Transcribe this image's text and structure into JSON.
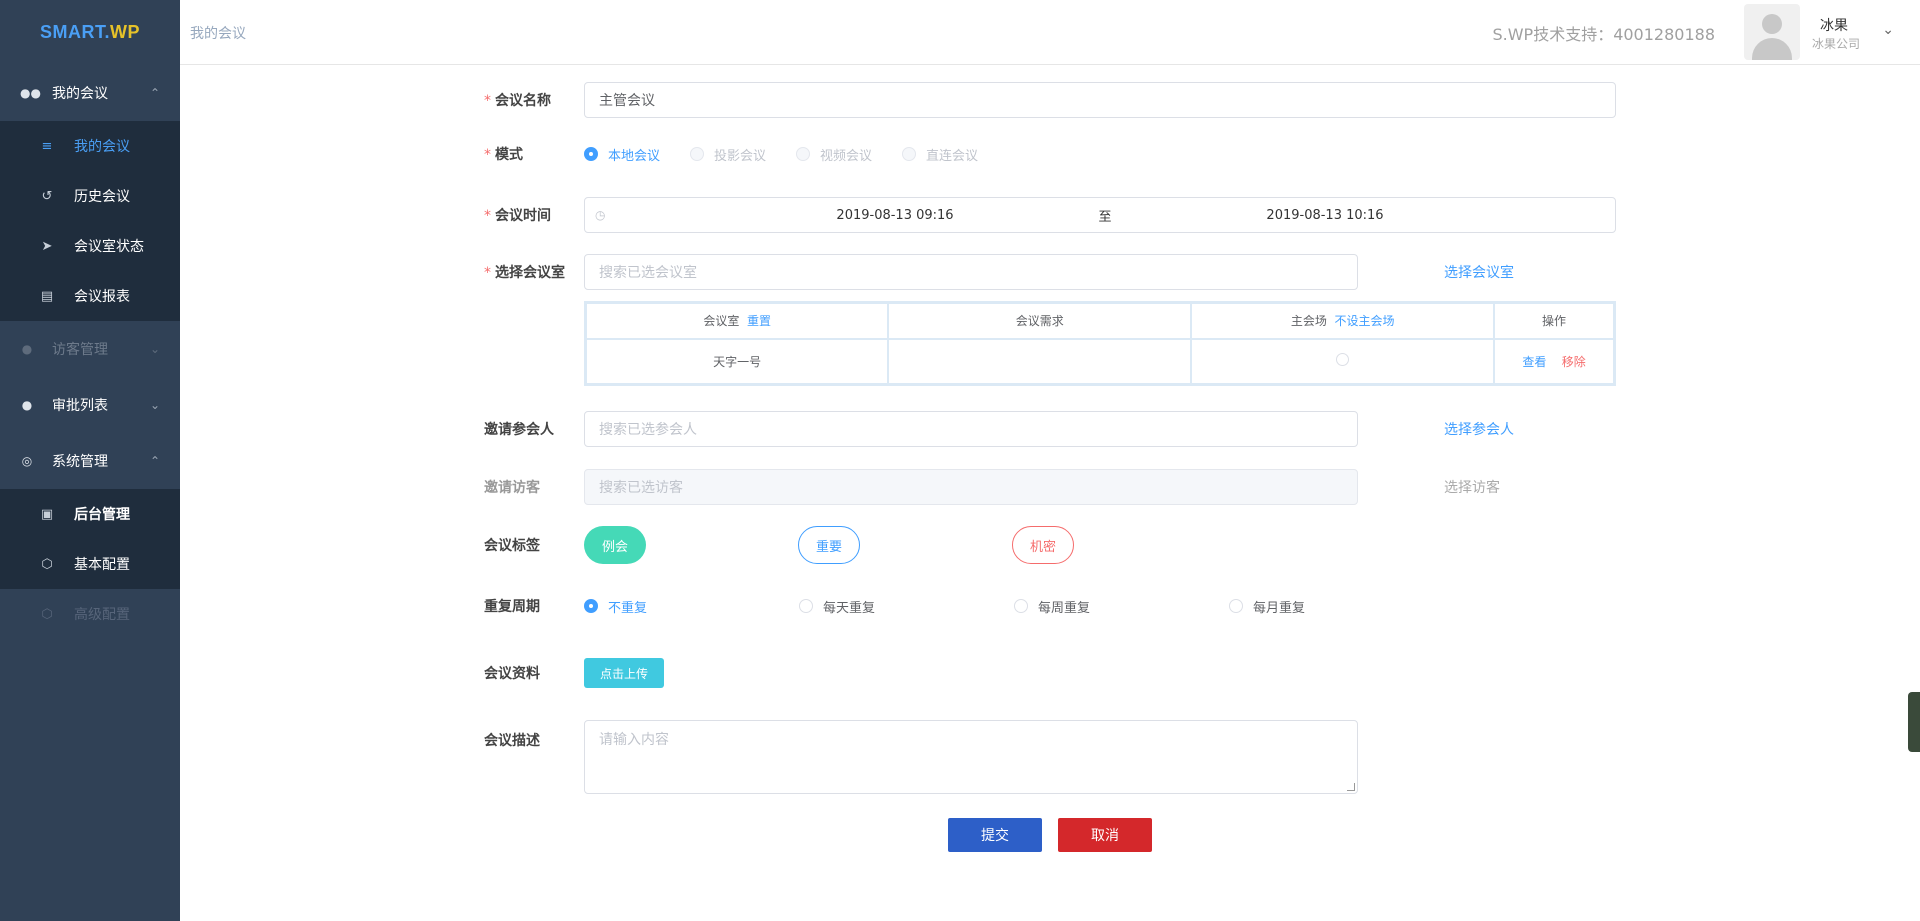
{
  "logo": {
    "main": "SMART.",
    "accent": "WP"
  },
  "sidebar": {
    "groups": [
      {
        "label": "我的会议",
        "icon": "people-icon",
        "expanded": true,
        "items": [
          {
            "label": "我的会议",
            "icon": "list-icon"
          },
          {
            "label": "历史会议",
            "icon": "history-icon"
          },
          {
            "label": "会议室状态",
            "icon": "send-icon"
          },
          {
            "label": "会议报表",
            "icon": "report-icon"
          }
        ]
      },
      {
        "label": "访客管理",
        "icon": "user-icon",
        "disabled": true
      },
      {
        "label": "审批列表",
        "icon": "user-icon"
      },
      {
        "label": "系统管理",
        "icon": "target-icon",
        "expanded": true,
        "items": [
          {
            "label": "后台管理",
            "icon": "image-icon"
          },
          {
            "label": "基本配置",
            "icon": "cube-icon"
          },
          {
            "label": "高级配置",
            "icon": "cube-icon",
            "disabled": true
          }
        ]
      }
    ]
  },
  "header": {
    "breadcrumb": "我的会议",
    "support": "S.WP技术支持：4001280188",
    "user_name": "冰果",
    "user_company": "冰果公司"
  },
  "form": {
    "name": {
      "label": "会议名称",
      "value": "主管会议"
    },
    "mode": {
      "label": "模式",
      "options": [
        "本地会议",
        "投影会议",
        "视频会议",
        "直连会议"
      ],
      "selected": "本地会议"
    },
    "time": {
      "label": "会议时间",
      "start": "2019-08-13  09:16",
      "sep": "至",
      "end": "2019-08-13  10:16"
    },
    "room": {
      "label": "选择会议室",
      "placeholder": "搜索已选会议室",
      "link": "选择会议室"
    },
    "room_table": {
      "headers": {
        "room": "会议室",
        "reset": "重置",
        "needs": "会议需求",
        "main": "主会场",
        "no_main": "不设主会场",
        "ops": "操作"
      },
      "rows": [
        {
          "room": "天字一号",
          "needs": "",
          "view": "查看",
          "remove": "移除"
        }
      ]
    },
    "attendees": {
      "label": "邀请参会人",
      "placeholder": "搜索已选参会人",
      "link": "选择参会人"
    },
    "visitors": {
      "label": "邀请访客",
      "placeholder": "搜索已选访客",
      "link": "选择访客"
    },
    "tags": {
      "label": "会议标签",
      "items": [
        "例会",
        "重要",
        "机密"
      ]
    },
    "repeat": {
      "label": "重复周期",
      "options": [
        "不重复",
        "每天重复",
        "每周重复",
        "每月重复"
      ],
      "selected": "不重复"
    },
    "files": {
      "label": "会议资料",
      "button": "点击上传"
    },
    "desc": {
      "label": "会议描述",
      "placeholder": "请输入内容"
    },
    "submit": "提交",
    "cancel": "取消"
  },
  "colors": {
    "sidebar": "#304156",
    "submenu": "#1f2d3d",
    "primary": "#409eff",
    "submit": "#2d5fc8",
    "cancel": "#d4282b",
    "tag_green": "#45d9b7",
    "upload": "#40c9e0"
  }
}
